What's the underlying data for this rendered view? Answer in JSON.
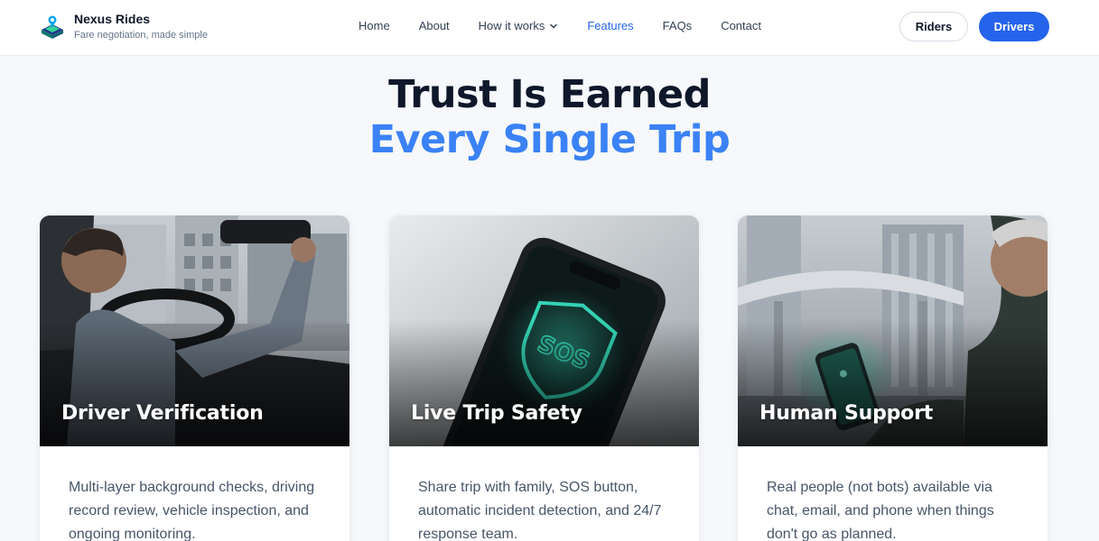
{
  "brand": {
    "name": "Nexus Rides",
    "tagline": "Fare negotiation, made simple"
  },
  "nav": {
    "home": "Home",
    "about": "About",
    "how_it_works": "How it works",
    "features": "Features",
    "faqs": "FAQs",
    "contact": "Contact"
  },
  "actions": {
    "riders": "Riders",
    "drivers": "Drivers"
  },
  "hero": {
    "line1": "Trust Is Earned",
    "line2": "Every Single Trip"
  },
  "cards": [
    {
      "title": "Driver Verification",
      "description": "Multi-layer background checks, driving record review, vehicle inspection, and ongoing monitoring."
    },
    {
      "title": "Live Trip Safety",
      "description": "Share trip with family, SOS button, automatic incident detection, and 24/7 response team."
    },
    {
      "title": "Human Support",
      "description": "Real people (not bots) available via chat, email, and phone when things don't go as planned."
    }
  ],
  "colors": {
    "accent": "#2563eb",
    "hero_accent": "#3b82f6",
    "sos_glow": "#34d3b4"
  },
  "icons": {
    "nav_dropdown": "chevron-down-icon",
    "brand": "map-pin-logo-icon"
  }
}
